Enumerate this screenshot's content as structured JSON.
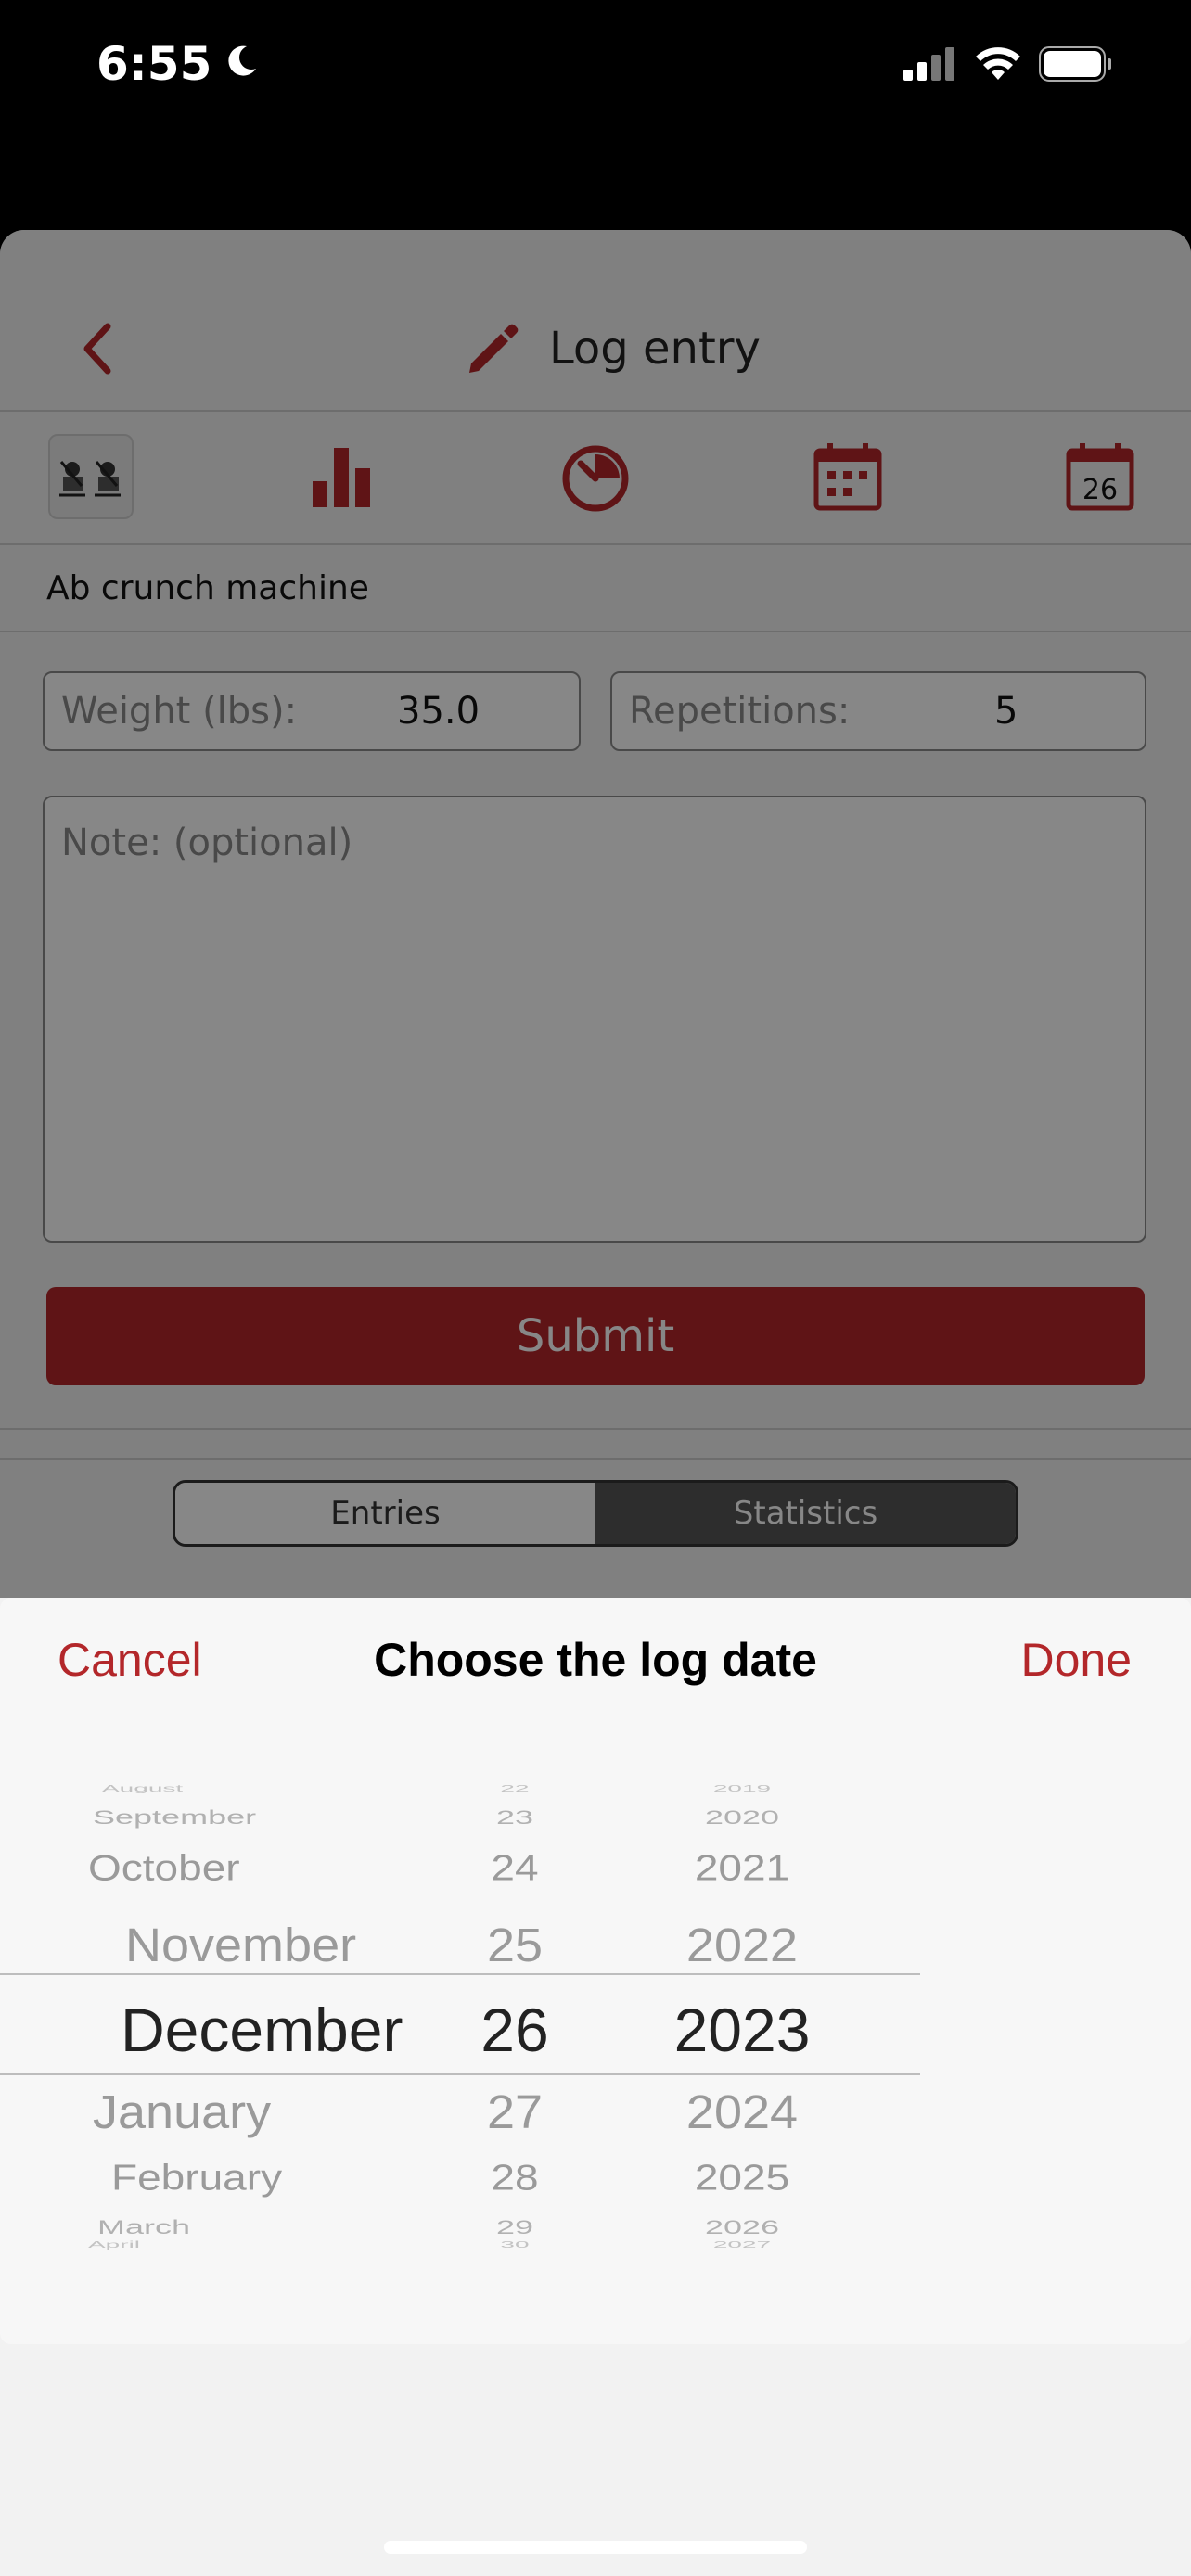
{
  "status": {
    "time": "6:55"
  },
  "nav": {
    "title": "Log entry"
  },
  "toolbar": {
    "calendar_day": "26"
  },
  "exercise": {
    "name": "Ab crunch machine"
  },
  "form": {
    "weight_label": "Weight (lbs):",
    "weight_value": "35.0",
    "reps_label": "Repetitions:",
    "reps_value": "5",
    "note_placeholder": "Note: (optional)",
    "submit_label": "Submit"
  },
  "segment": {
    "entries_label": "Entries",
    "statistics_label": "Statistics",
    "selected": "Statistics"
  },
  "picker": {
    "cancel_label": "Cancel",
    "title": "Choose the log date",
    "done_label": "Done",
    "months": [
      "August",
      "September",
      "October",
      "November",
      "December",
      "January",
      "February",
      "March",
      "April"
    ],
    "days": [
      "22",
      "23",
      "24",
      "25",
      "26",
      "27",
      "28",
      "29",
      "30"
    ],
    "years": [
      "2019",
      "2020",
      "2021",
      "2022",
      "2023",
      "2024",
      "2025",
      "2026",
      "2027"
    ],
    "selected_month": "December",
    "selected_day": "26",
    "selected_year": "2023"
  },
  "colors": {
    "accent": "#b3272a",
    "background": "#f2f2f2"
  }
}
